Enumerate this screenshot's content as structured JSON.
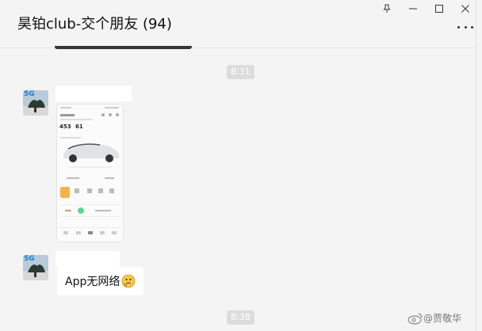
{
  "chat": {
    "title": "昊铂club-交个朋友 (94)"
  },
  "window_controls": {
    "pin_icon": "pin-icon",
    "minimize_icon": "minimize-icon",
    "maximize_icon": "maximize-icon",
    "close_icon": "close-icon",
    "more_icon": "more-icon"
  },
  "messages": [
    {
      "type": "time",
      "text": "8:31"
    },
    {
      "type": "image",
      "sender": "5G avatar",
      "content": "car app screenshot"
    },
    {
      "type": "text",
      "sender": "5G avatar",
      "text": "App无网络",
      "emoji": "thinking-face"
    },
    {
      "type": "time",
      "text": "8:38"
    }
  ],
  "avatar": {
    "badge": "5G"
  },
  "screenshot": {
    "num1": "453",
    "num2": "61"
  },
  "watermark": {
    "text": "@贾敬华"
  },
  "colors": {
    "background": "#f4f4f4",
    "bubble": "#ffffff",
    "time_pill": "#dcdcdc",
    "accent_orange": "#f6b24a",
    "accent_green": "#5fd39a"
  }
}
